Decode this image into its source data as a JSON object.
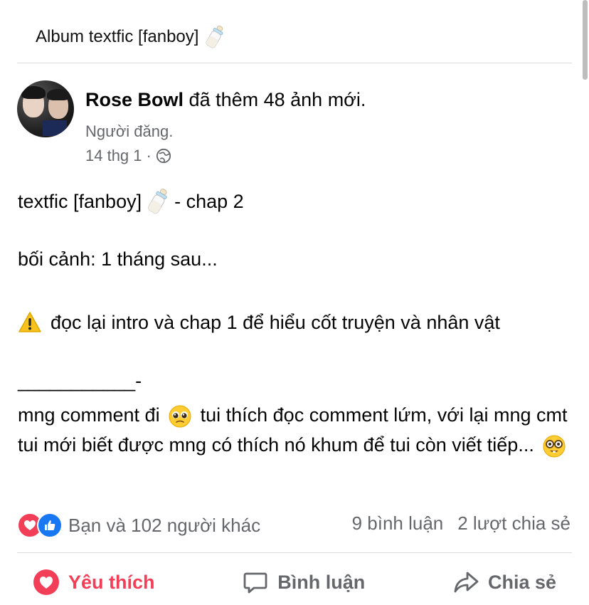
{
  "header": {
    "album_title": "Album textfic [fanboy]",
    "album_emoji": "baby-bottle-icon"
  },
  "post": {
    "author": "Rose Bowl",
    "action_text": "đã thêm 48 ảnh mới.",
    "poster_label": "Người đăng.",
    "timestamp": "14 thg 1",
    "separator_dot": "·",
    "privacy_icon": "globe-icon",
    "body": {
      "title_text": "textfic [fanboy]",
      "title_suffix": "- chap 2",
      "setting": "bối cảnh: 1 tháng sau...",
      "warning": "đọc lại intro và chap 1 để hiểu cốt truyện và nhân vật",
      "separator": "___________-",
      "cta_part1": "mng comment đi",
      "cta_part2": "tui thích đọc comment lứm, với lại mng cmt tui mới biết được mng có thích nó khum để tui còn viết tiếp..."
    }
  },
  "engagement": {
    "reactions_text": "Bạn và 102 người khác",
    "comments": "9 bình luận",
    "shares": "2 lượt chia sẻ"
  },
  "actions": {
    "like": "Yêu thích",
    "comment": "Bình luận",
    "share": "Chia sẻ"
  },
  "colors": {
    "love": "#f33e58",
    "like": "#1877f2",
    "secondary_text": "#65676b"
  }
}
